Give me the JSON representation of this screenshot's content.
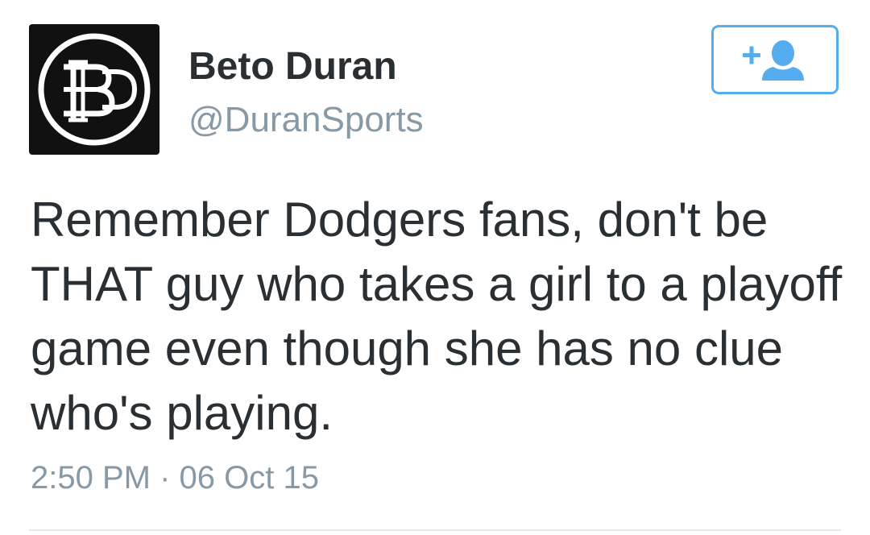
{
  "author": {
    "display_name": "Beto Duran",
    "handle": "@DuranSports",
    "avatar_icon": "bd-logo-avatar",
    "avatar_logo_text": "BD"
  },
  "follow_button": {
    "icon": "add-user-icon",
    "color": "#55acee"
  },
  "tweet": {
    "text": "Remember Dodgers fans, don't be THAT guy who takes a girl to a playoff game even though she has no clue who's playing.",
    "timestamp": "2:50 PM · 06 Oct 15"
  },
  "colors": {
    "name": "#292f33",
    "secondary": "#8899a6",
    "accent": "#55acee",
    "divider": "#e1e8ed"
  }
}
